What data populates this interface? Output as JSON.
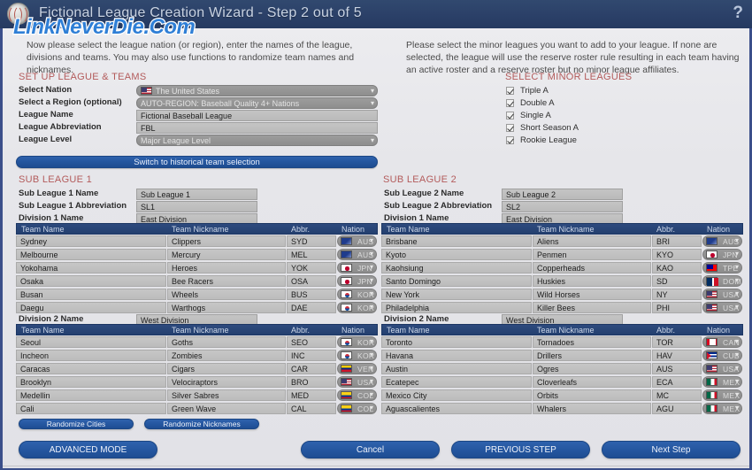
{
  "window": {
    "title": "Fictional League Creation Wizard - Step 2 out of 5",
    "help_label": "?",
    "logo_name": "baseball-logo",
    "watermark": "LinkNeverDie.Com",
    "title_bar_color": "#2b4068",
    "accent_blue": "#2557a0",
    "section_header_color": "#b35b5b"
  },
  "intro": {
    "left": "Now please select the league nation (or region), enter the names of the league, divisions and teams. You may also use functions to randomize team names and nicknames.",
    "right": "Please select the minor leagues you want to add to your league. If none are selected, the league will use the reserve roster rule resulting in each team having an active roster and a reserve roster but no minor league affiliates."
  },
  "setup": {
    "header": "SET UP LEAGUE & TEAMS",
    "fields": [
      {
        "label": "Select Nation",
        "value": "The United States",
        "type": "select",
        "flag": "usa"
      },
      {
        "label": "Select a Region (optional)",
        "value": "AUTO-REGION: Baseball Quality 4+ Nations",
        "type": "select",
        "flag": ""
      },
      {
        "label": "League Name",
        "value": "Fictional Baseball League",
        "type": "text",
        "flag": ""
      },
      {
        "label": "League Abbreviation",
        "value": "FBL",
        "type": "text",
        "flag": ""
      },
      {
        "label": "League Level",
        "value": "Major League Level",
        "type": "select",
        "flag": ""
      }
    ],
    "switch_button": "Switch to historical team selection"
  },
  "minor_leagues": {
    "header": "SELECT MINOR LEAGUES",
    "items": [
      {
        "label": "Triple A",
        "checked": true
      },
      {
        "label": "Double A",
        "checked": true
      },
      {
        "label": "Single A",
        "checked": true
      },
      {
        "label": "Short Season A",
        "checked": true
      },
      {
        "label": "Rookie League",
        "checked": true
      }
    ]
  },
  "table_headers": [
    "Team Name",
    "Team Nickname",
    "Abbr.",
    "Nation"
  ],
  "sub_league_1": {
    "header": "SUB LEAGUE 1",
    "fields": [
      {
        "label": "Sub League 1 Name",
        "value": "Sub League 1"
      },
      {
        "label": "Sub League 1 Abbreviation",
        "value": "SL1"
      }
    ],
    "division_1": {
      "label": "Division 1 Name",
      "value": "East Division",
      "teams": [
        {
          "name": "Sydney",
          "nickname": "Clippers",
          "abbr": "SYD",
          "nation": "AUS",
          "flag": "aus"
        },
        {
          "name": "Melbourne",
          "nickname": "Mercury",
          "abbr": "MEL",
          "nation": "AUS",
          "flag": "aus"
        },
        {
          "name": "Yokohama",
          "nickname": "Heroes",
          "abbr": "YOK",
          "nation": "JPN",
          "flag": "jpn"
        },
        {
          "name": "Osaka",
          "nickname": "Bee Racers",
          "abbr": "OSA",
          "nation": "JPN",
          "flag": "jpn"
        },
        {
          "name": "Busan",
          "nickname": "Wheels",
          "abbr": "BUS",
          "nation": "KOR",
          "flag": "kor"
        },
        {
          "name": "Daegu",
          "nickname": "Warthogs",
          "abbr": "DAE",
          "nation": "KOR",
          "flag": "kor"
        }
      ]
    },
    "division_2": {
      "label": "Division 2 Name",
      "value": "West Division",
      "teams": [
        {
          "name": "Seoul",
          "nickname": "Goths",
          "abbr": "SEO",
          "nation": "KOR",
          "flag": "kor"
        },
        {
          "name": "Incheon",
          "nickname": "Zombies",
          "abbr": "INC",
          "nation": "KOR",
          "flag": "kor"
        },
        {
          "name": "Caracas",
          "nickname": "Cigars",
          "abbr": "CAR",
          "nation": "VEN",
          "flag": "ven"
        },
        {
          "name": "Brooklyn",
          "nickname": "Velociraptors",
          "abbr": "BRO",
          "nation": "USA",
          "flag": "usa"
        },
        {
          "name": "Medellin",
          "nickname": "Silver Sabres",
          "abbr": "MED",
          "nation": "COL",
          "flag": "col"
        },
        {
          "name": "Cali",
          "nickname": "Green Wave",
          "abbr": "CAL",
          "nation": "COL",
          "flag": "col"
        }
      ]
    }
  },
  "sub_league_2": {
    "header": "SUB LEAGUE 2",
    "fields": [
      {
        "label": "Sub League 2 Name",
        "value": "Sub League 2"
      },
      {
        "label": "Sub League 2 Abbreviation",
        "value": "SL2"
      }
    ],
    "division_1": {
      "label": "Division 1 Name",
      "value": "East Division",
      "teams": [
        {
          "name": "Brisbane",
          "nickname": "Aliens",
          "abbr": "BRI",
          "nation": "AUS",
          "flag": "aus"
        },
        {
          "name": "Kyoto",
          "nickname": "Penmen",
          "abbr": "KYO",
          "nation": "JPN",
          "flag": "jpn"
        },
        {
          "name": "Kaohsiung",
          "nickname": "Copperheads",
          "abbr": "KAO",
          "nation": "TPE",
          "flag": "tpe"
        },
        {
          "name": "Santo Domingo",
          "nickname": "Huskies",
          "abbr": "SD",
          "nation": "DOM",
          "flag": "dom"
        },
        {
          "name": "New York",
          "nickname": "Wild Horses",
          "abbr": "NY",
          "nation": "USA",
          "flag": "usa"
        },
        {
          "name": "Philadelphia",
          "nickname": "Killer Bees",
          "abbr": "PHI",
          "nation": "USA",
          "flag": "usa"
        }
      ]
    },
    "division_2": {
      "label": "Division 2 Name",
      "value": "West Division",
      "teams": [
        {
          "name": "Toronto",
          "nickname": "Tornadoes",
          "abbr": "TOR",
          "nation": "CAN",
          "flag": "can"
        },
        {
          "name": "Havana",
          "nickname": "Drillers",
          "abbr": "HAV",
          "nation": "CUB",
          "flag": "cub"
        },
        {
          "name": "Austin",
          "nickname": "Ogres",
          "abbr": "AUS",
          "nation": "USA",
          "flag": "usa"
        },
        {
          "name": "Ecatepec",
          "nickname": "Cloverleafs",
          "abbr": "ECA",
          "nation": "MEX",
          "flag": "mex"
        },
        {
          "name": "Mexico City",
          "nickname": "Orbits",
          "abbr": "MC",
          "nation": "MEX",
          "flag": "mex"
        },
        {
          "name": "Aguascalientes",
          "nickname": "Whalers",
          "abbr": "AGU",
          "nation": "MEX",
          "flag": "mex"
        }
      ]
    }
  },
  "randomize": {
    "cities": "Randomize Cities",
    "nicknames": "Randomize Nicknames"
  },
  "footer": {
    "advanced_mode": "ADVANCED MODE",
    "cancel": "Cancel",
    "previous_step": "PREVIOUS STEP",
    "next_step": "Next Step"
  }
}
